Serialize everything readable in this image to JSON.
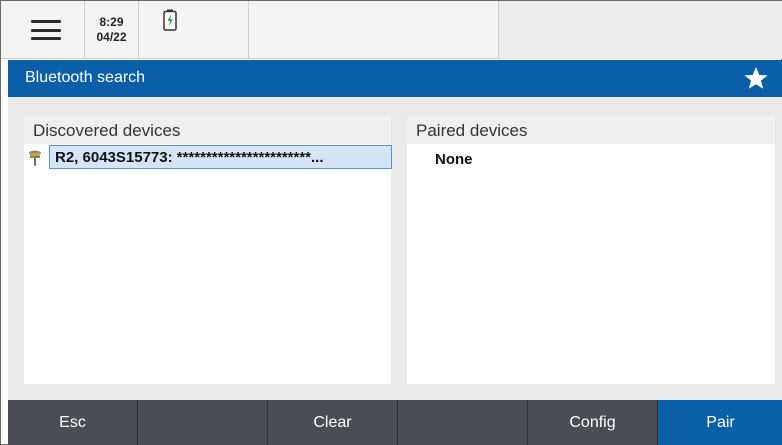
{
  "status_bar": {
    "time": "8:29",
    "date": "04/22",
    "battery_state": "charging"
  },
  "title_bar": {
    "title": "Bluetooth search",
    "favorite_icon": "star-icon"
  },
  "discovered_panel": {
    "header": "Discovered devices",
    "devices": [
      {
        "label": "R2, 6043S15773: ***********************...",
        "icon": "gnss-receiver-icon"
      }
    ]
  },
  "paired_panel": {
    "header": "Paired devices",
    "empty_text": "None"
  },
  "bottom_bar": {
    "buttons": [
      "Esc",
      "",
      "Clear",
      "",
      "Config",
      "Pair"
    ]
  },
  "colors": {
    "accent": "#0a5fa8",
    "bottom_bar": "#4a4d53",
    "selection": "#d4e5f7"
  }
}
